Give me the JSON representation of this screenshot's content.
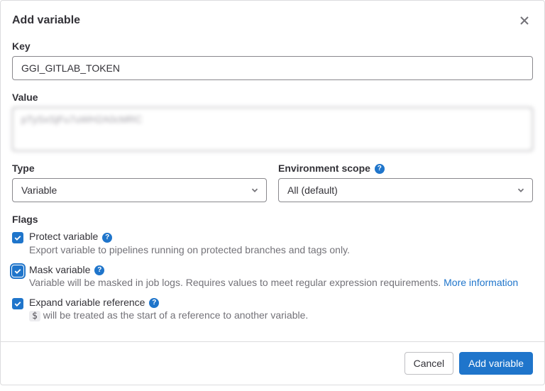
{
  "modal": {
    "title": "Add variable",
    "key_label": "Key",
    "key_value": "GGI_GITLAB_TOKEN",
    "value_label": "Value",
    "value_text": "pTySxSjFu7uWH2A0cMRC",
    "type_label": "Type",
    "type_selected": "Variable",
    "scope_label": "Environment scope",
    "scope_selected": "All (default)",
    "flags_label": "Flags",
    "flags": {
      "protect": {
        "label": "Protect variable",
        "desc": "Export variable to pipelines running on protected branches and tags only."
      },
      "mask": {
        "label": "Mask variable",
        "desc": "Variable will be masked in job logs. Requires values to meet regular expression requirements.",
        "link": "More information"
      },
      "expand": {
        "label": "Expand variable reference",
        "desc_prefix": " will be treated as the start of a reference to another variable.",
        "code": "$"
      }
    },
    "cancel": "Cancel",
    "submit": "Add variable"
  }
}
